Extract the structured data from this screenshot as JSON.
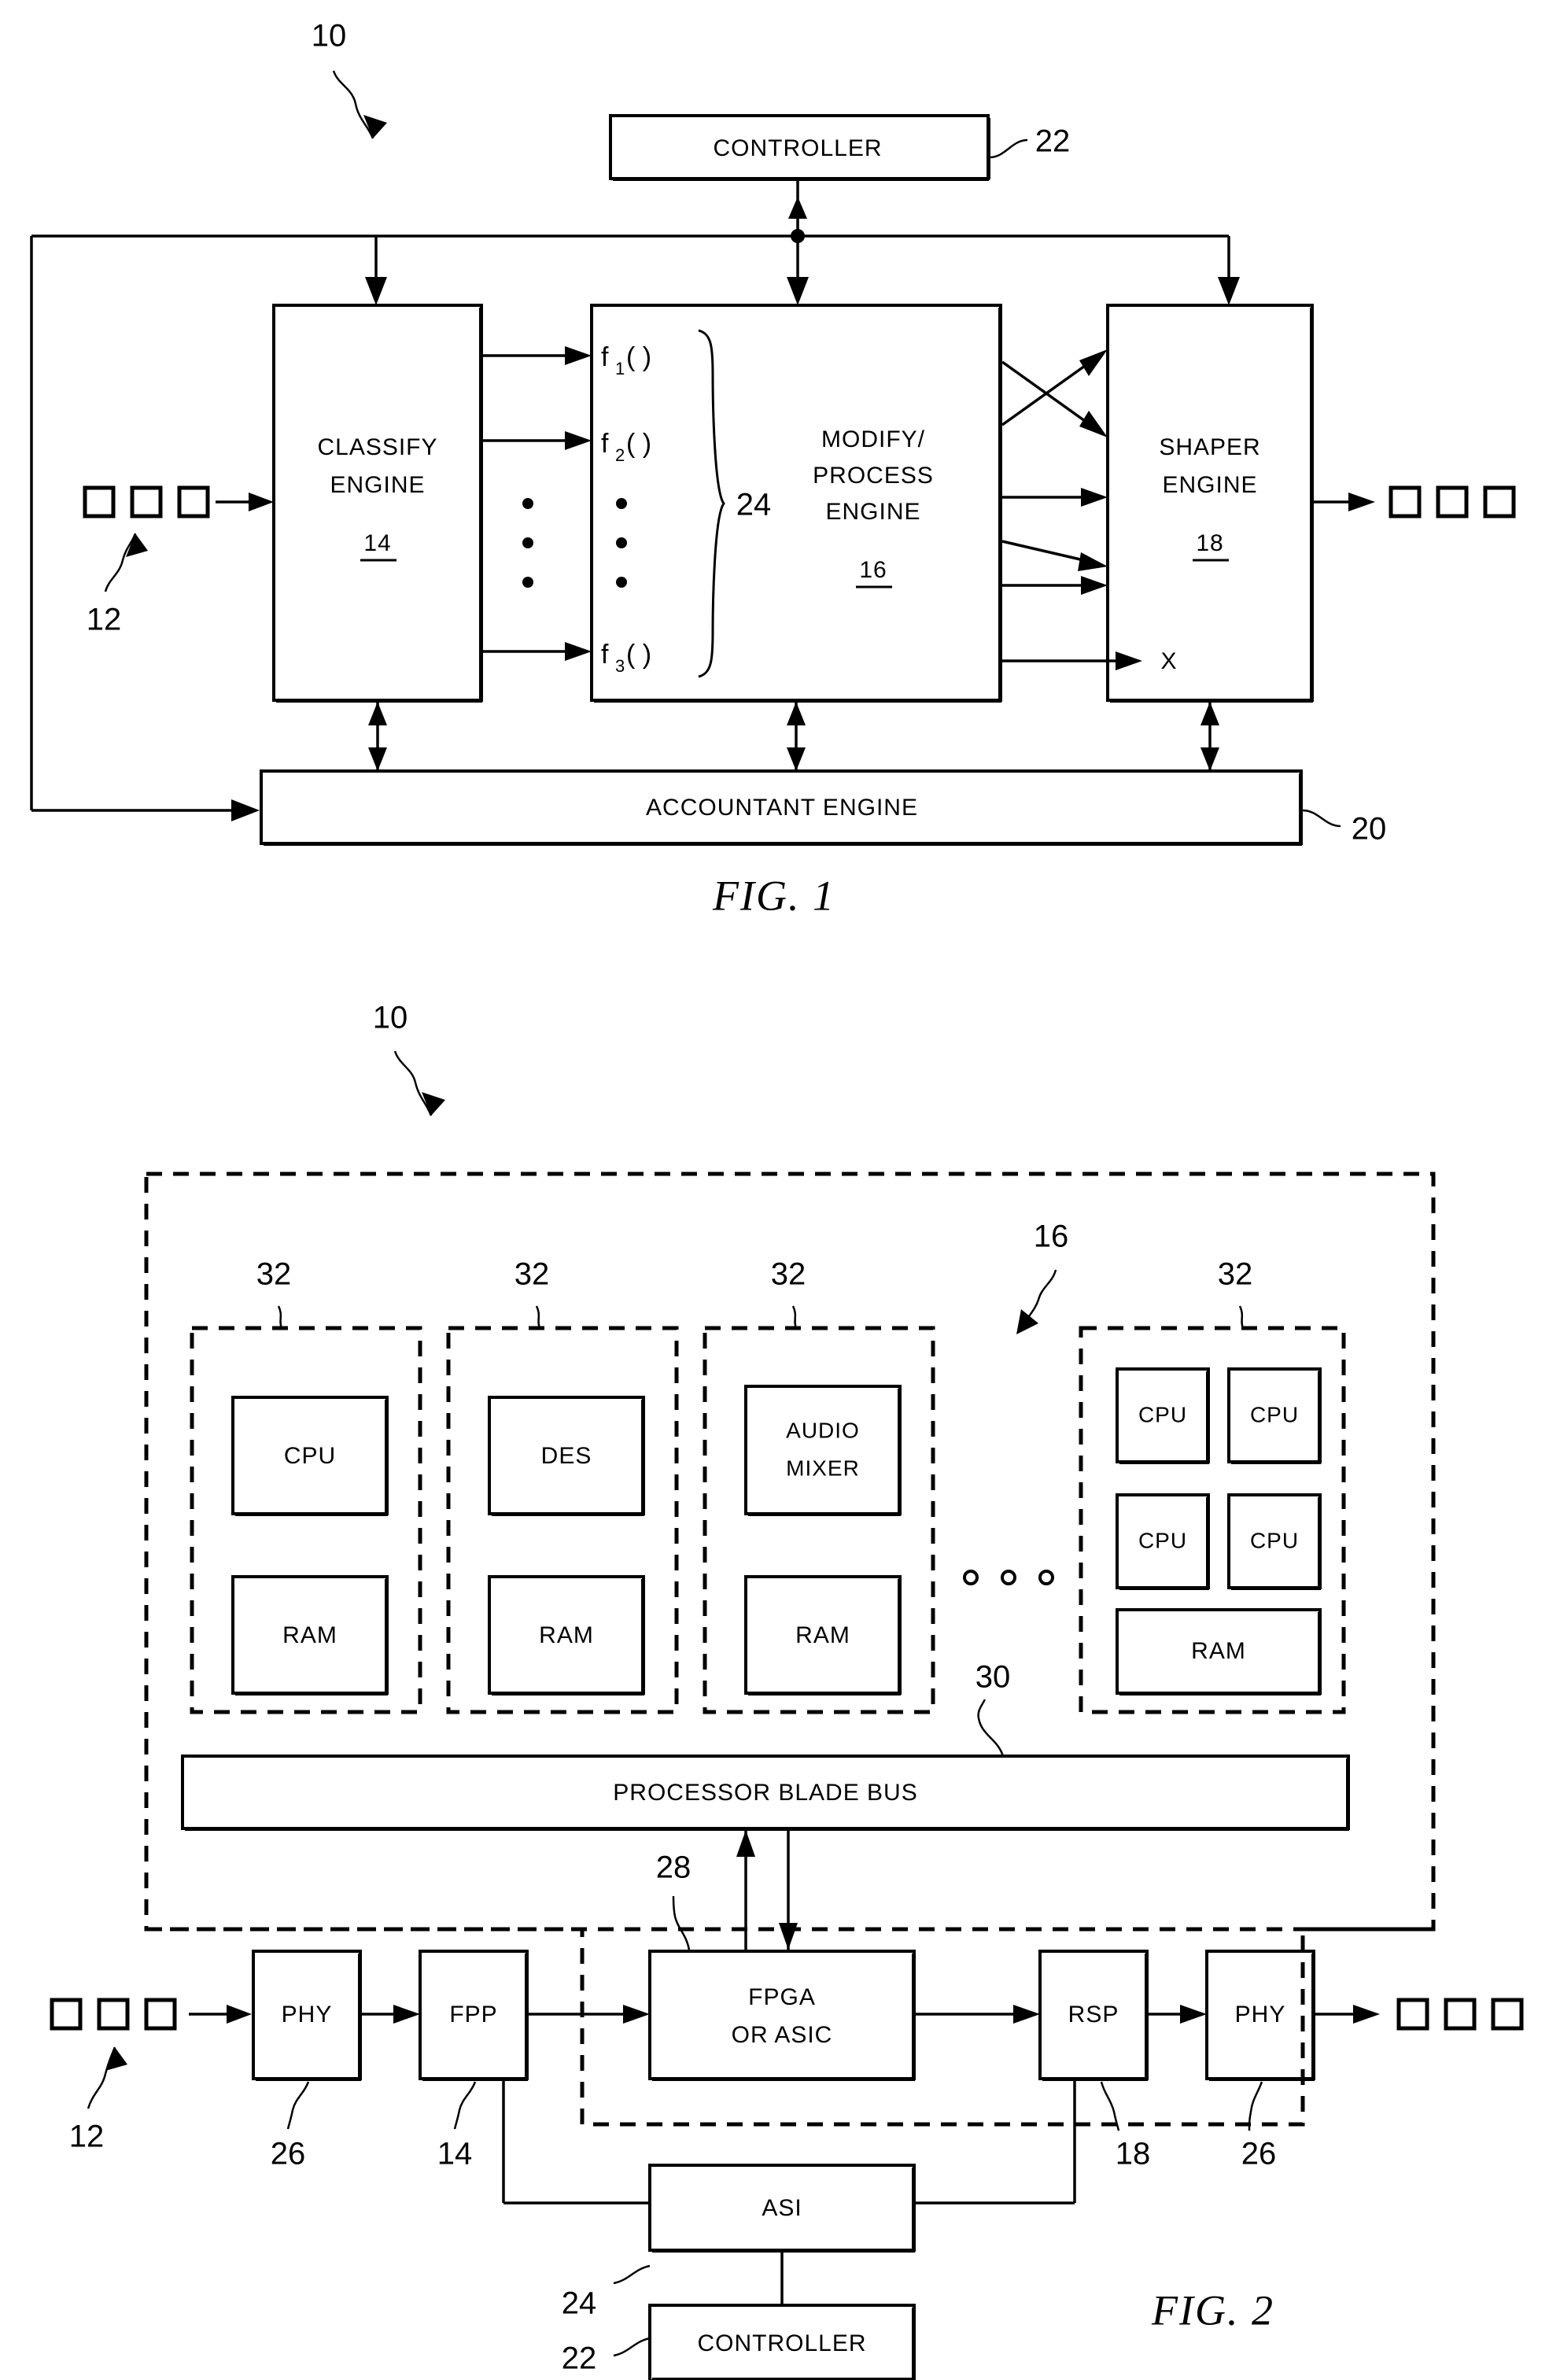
{
  "document": {
    "type": "patent-drawing-sheet",
    "figures": [
      "FIG. 1",
      "FIG. 2"
    ]
  },
  "fig1": {
    "caption": "FIG.  1",
    "system_ref": "10",
    "blocks": {
      "controller": {
        "label": "CONTROLLER",
        "ref": "22"
      },
      "classify": {
        "label_line1": "CLASSIFY",
        "label_line2": "ENGINE",
        "ref": "14"
      },
      "modify": {
        "label_line1": "MODIFY/",
        "label_line2": "PROCESS",
        "label_line3": "ENGINE",
        "ref": "16"
      },
      "shaper": {
        "label_line1": "SHAPER",
        "label_line2": "ENGINE",
        "ref": "18"
      },
      "accountant": {
        "label": "ACCOUNTANT  ENGINE",
        "ref": "20"
      }
    },
    "functions": {
      "ref": "24",
      "items": [
        {
          "base": "f",
          "sub": "1",
          "args": "( )"
        },
        {
          "base": "f",
          "sub": "2",
          "args": "( )"
        },
        {
          "base": "f",
          "sub": "3",
          "args": "( )"
        }
      ],
      "ellipsis": "•"
    },
    "packets": {
      "ref": "12",
      "count": 3
    },
    "output_packets": {
      "count": 3
    },
    "drop_label": "X"
  },
  "fig2": {
    "caption": "FIG.  2",
    "system_ref": "10",
    "blade_bus": {
      "label": "PROCESSOR  BLADE  BUS",
      "ref": "30"
    },
    "blade_group_ref": "32",
    "modify_ref": "16",
    "blades": [
      {
        "ref": "32",
        "top": [
          "CPU"
        ],
        "bottom": "RAM",
        "layout": "single"
      },
      {
        "ref": "32",
        "top": [
          "DES"
        ],
        "bottom": "RAM",
        "layout": "single"
      },
      {
        "ref": "32",
        "top": [
          "AUDIO",
          "MIXER"
        ],
        "bottom": "RAM",
        "layout": "single-two-line"
      },
      {
        "ref": "32",
        "top": [
          "CPU",
          "CPU",
          "CPU",
          "CPU"
        ],
        "bottom": "RAM",
        "layout": "quad"
      }
    ],
    "ellipsis_between_blades": "○ ○ ○",
    "datapath": [
      {
        "label": "PHY",
        "ref": "26"
      },
      {
        "label": "FPP",
        "ref": "14"
      },
      {
        "label_line1": "FPGA",
        "label_line2": "OR ASIC",
        "ref": "28"
      },
      {
        "label": "RSP",
        "ref": "18"
      },
      {
        "label": "PHY",
        "ref": "26"
      }
    ],
    "asi": {
      "label": "ASI",
      "ref": "24"
    },
    "controller": {
      "label": "CONTROLLER",
      "ref": "22"
    },
    "input_packets": {
      "ref": "12",
      "count": 3
    },
    "output_packets": {
      "count": 3
    }
  },
  "colors": {
    "ink": "#000000",
    "paper": "#ffffff"
  }
}
